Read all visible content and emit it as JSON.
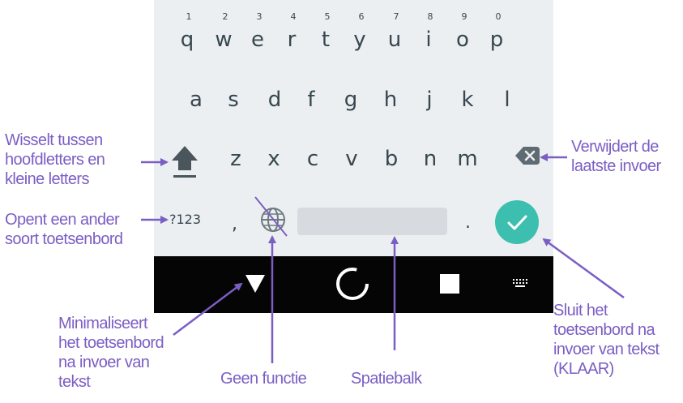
{
  "keyboard": {
    "row1": [
      "q",
      "w",
      "e",
      "r",
      "t",
      "y",
      "u",
      "i",
      "o",
      "p"
    ],
    "row1_hints": [
      "1",
      "2",
      "3",
      "4",
      "5",
      "6",
      "7",
      "8",
      "9",
      "0"
    ],
    "row2": [
      "a",
      "s",
      "d",
      "f",
      "g",
      "h",
      "j",
      "k",
      "l"
    ],
    "row3": [
      "z",
      "x",
      "c",
      "v",
      "b",
      "n",
      "m"
    ],
    "symbols_label": "?123",
    "comma": ",",
    "period": ".",
    "shift_icon": "shift-arrow-icon",
    "backspace_icon": "backspace-icon",
    "globe_icon": "globe-icon",
    "done_icon": "checkmark-icon",
    "accent_color": "#3dbfb0"
  },
  "navbar": {
    "back_icon": "triangle-down-icon",
    "home_icon": "circle-icon",
    "recents_icon": "square-icon",
    "keyboard_icon": "keyboard-icon"
  },
  "callouts": {
    "shift": [
      "Wisselt tussen",
      "hoofdletters en",
      "kleine letters"
    ],
    "symbols": [
      "Opent een ander",
      "soort toetsenbord"
    ],
    "backspace": [
      "Verwijdert de",
      "laatste invoer"
    ],
    "minimize": [
      "Minimaliseert",
      "het toetsenbord",
      "na invoer van",
      "tekst"
    ],
    "globe": [
      "Geen functie"
    ],
    "space": [
      "Spatiebalk"
    ],
    "done": [
      "Sluit het",
      "toetsenbord na",
      "invoer van tekst",
      "(KLAAR)"
    ]
  },
  "annotation_color": "#7b5ec4"
}
